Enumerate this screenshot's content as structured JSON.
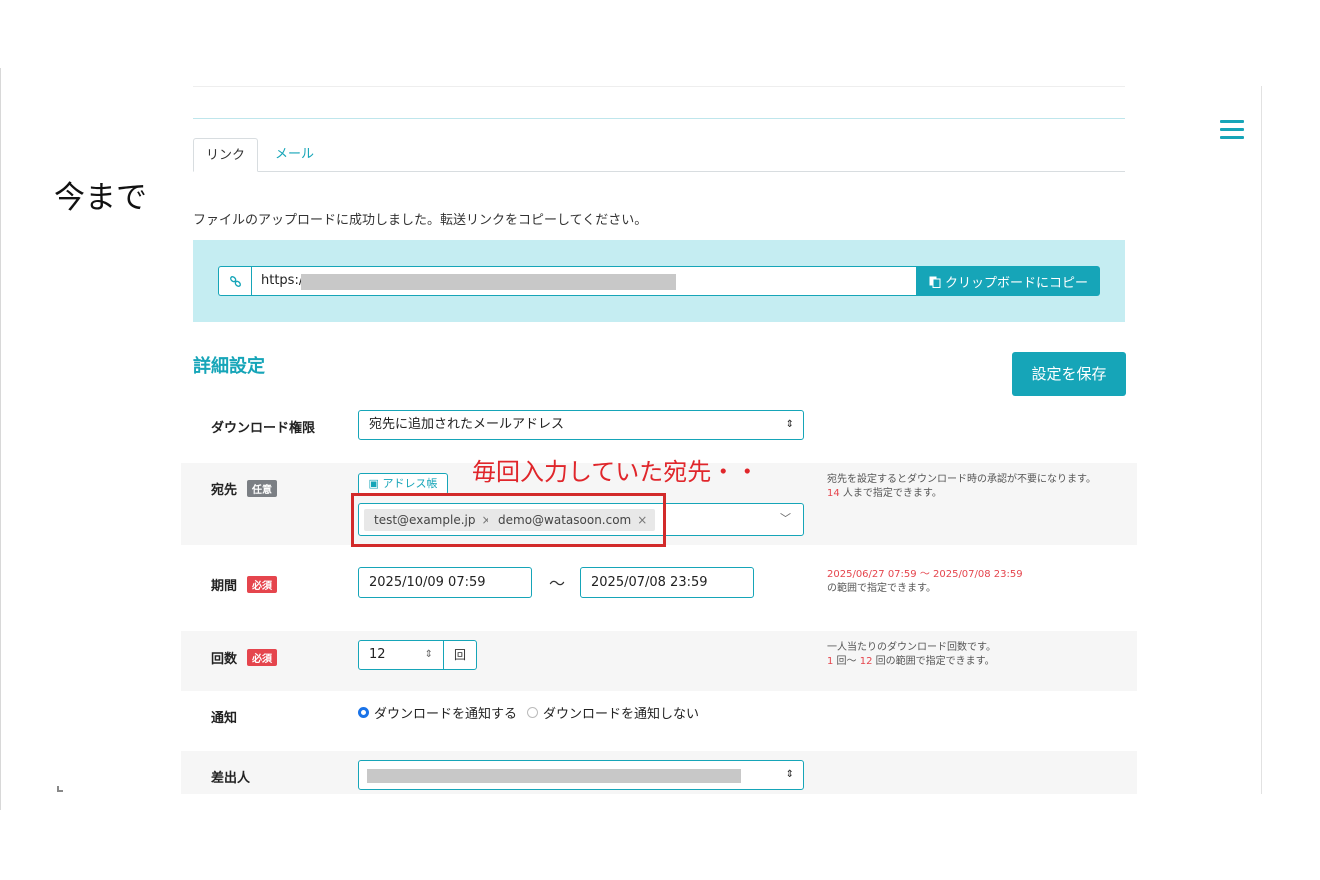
{
  "side_note": "今まで",
  "tabs": [
    {
      "label": "リンク",
      "active": true
    },
    {
      "label": "メール",
      "active": false
    }
  ],
  "success_message": "ファイルのアップロードに成功しました。転送リンクをコピーしてください。",
  "link": {
    "url_prefix": "https:/",
    "link_icon": "link-icon",
    "copy_button": "クリップボードにコピー",
    "copy_icon": "clipboard-icon"
  },
  "section_title": "詳細設定",
  "save_button": "設定を保存",
  "download_permission": {
    "label": "ダウンロード権限",
    "value": "宛先に追加されたメールアドレス"
  },
  "recipients": {
    "label": "宛先",
    "badge": "任意",
    "address_book_button": "アドレス帳",
    "tags": [
      "test@example.jp",
      "demo@watasoon.com"
    ],
    "help_line1": "宛先を設定するとダウンロード時の承認が不要になります。",
    "help_max": "14",
    "help_line2_suffix": " 人まで指定できます。"
  },
  "annotation": "毎回入力していた宛先・・",
  "period": {
    "label": "期間",
    "badge": "必須",
    "start": "2025/10/09 07:59",
    "separator": "〜",
    "end": "2025/07/08 23:59",
    "help_range": "2025/06/27 07:59 〜 2025/07/08 23:59",
    "help_suffix": "の範囲で指定できます。"
  },
  "count": {
    "label": "回数",
    "badge": "必須",
    "value": "12",
    "unit": "回",
    "help_line1": "一人当たりのダウンロード回数です。",
    "help_min": "1",
    "help_mid": " 回〜 ",
    "help_max": "12",
    "help_suffix": " 回の範囲で指定できます。"
  },
  "notify": {
    "label": "通知",
    "options": [
      {
        "label": "ダウンロードを通知する",
        "selected": true
      },
      {
        "label": "ダウンロードを通知しない",
        "selected": false
      }
    ]
  },
  "sender": {
    "label": "差出人"
  },
  "colors": {
    "accent": "#16a5b8",
    "required": "#e5454d",
    "annotation": "#e0262b"
  }
}
